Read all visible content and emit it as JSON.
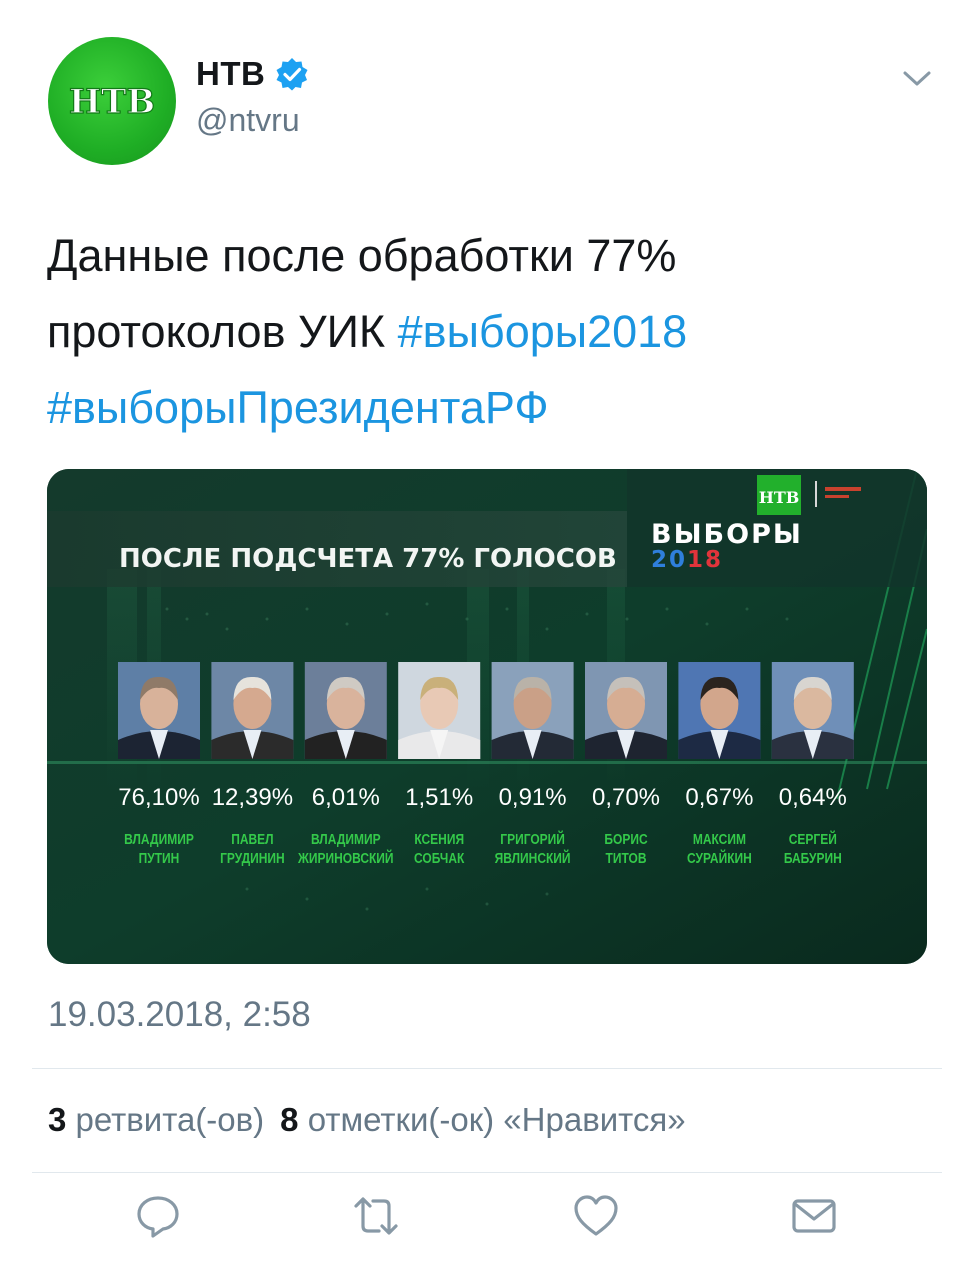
{
  "author": {
    "name": "НТВ",
    "handle": "@ntvru",
    "avatar_logo_text": "НТВ",
    "verified": true
  },
  "tweet": {
    "text_plain": "Данные после обработки 77% протоколов УИК",
    "hashtags": [
      "#выборы2018",
      "#выборыПрезидентаРФ"
    ],
    "timestamp": "19.03.2018, 2:58"
  },
  "media": {
    "header_label": "ПОСЛЕ ПОДСЧЕТА 77% ГОЛОСОВ",
    "election_title": "ВЫБОРЫ",
    "election_year": "2018",
    "logo_text": "НТВ",
    "candidates": [
      {
        "percent": "76,10%",
        "first_name": "ВЛАДИМИР",
        "last_name": "ПУТИН",
        "value": 76.1
      },
      {
        "percent": "12,39%",
        "first_name": "ПАВЕЛ",
        "last_name": "ГРУДИНИН",
        "value": 12.39
      },
      {
        "percent": "6,01%",
        "first_name": "ВЛАДИМИР",
        "last_name": "ЖИРИНОВСКИЙ",
        "value": 6.01
      },
      {
        "percent": "1,51%",
        "first_name": "КСЕНИЯ",
        "last_name": "СОБЧАК",
        "value": 1.51
      },
      {
        "percent": "0,91%",
        "first_name": "ГРИГОРИЙ",
        "last_name": "ЯВЛИНСКИЙ",
        "value": 0.91
      },
      {
        "percent": "0,70%",
        "first_name": "БОРИС",
        "last_name": "ТИТОВ",
        "value": 0.7
      },
      {
        "percent": "0,67%",
        "first_name": "МАКСИМ",
        "last_name": "СУРАЙКИН",
        "value": 0.67
      },
      {
        "percent": "0,64%",
        "first_name": "СЕРГЕЙ",
        "last_name": "БАБУРИН",
        "value": 0.64
      }
    ]
  },
  "stats": {
    "retweets_count": "3",
    "retweets_label": "ретвита(-ов)",
    "likes_count": "8",
    "likes_label": "отметки(-ок) «Нравится»"
  },
  "actions": [
    "reply-icon",
    "retweet-icon",
    "like-icon",
    "share-icon"
  ],
  "colors": {
    "hashtag": "#1b95e0",
    "ntv_green": "#1fae25",
    "candidate_name": "#34c94a",
    "secondary_text": "#657786"
  }
}
